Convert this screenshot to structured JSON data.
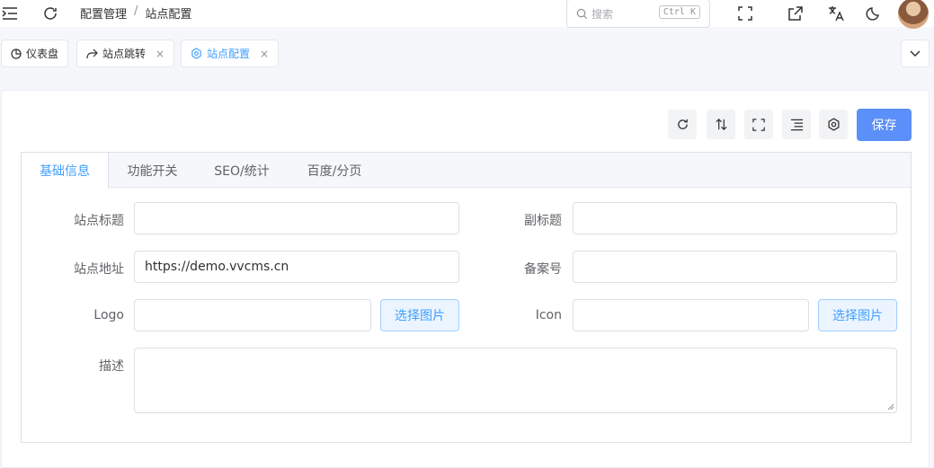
{
  "header": {
    "breadcrumb": [
      "配置管理",
      "站点配置"
    ],
    "breadcrumb_sep": "/",
    "search_placeholder": "搜索",
    "search_shortcut": "Ctrl K"
  },
  "tags": [
    {
      "label": "仪表盘",
      "icon": "dashboard-icon",
      "closable": false
    },
    {
      "label": "站点跳转",
      "icon": "share-icon",
      "closable": true
    },
    {
      "label": "站点配置",
      "icon": "gear-icon",
      "closable": true,
      "active": true
    }
  ],
  "tag_close": "×",
  "toolbar": {
    "save_label": "保存"
  },
  "tabs": [
    "基础信息",
    "功能开关",
    "SEO/统计",
    "百度/分页"
  ],
  "form": {
    "site_title_label": "站点标题",
    "site_title_value": "",
    "subtitle_label": "副标题",
    "subtitle_value": "",
    "site_url_label": "站点地址",
    "site_url_value": "https://demo.vvcms.cn",
    "icp_label": "备案号",
    "icp_value": "",
    "logo_label": "Logo",
    "logo_value": "",
    "logo_button": "选择图片",
    "icon_label": "Icon",
    "icon_value": "",
    "icon_button": "选择图片",
    "desc_label": "描述",
    "desc_value": ""
  },
  "colors": {
    "primary": "#409eff",
    "save": "#5b8ff9"
  }
}
